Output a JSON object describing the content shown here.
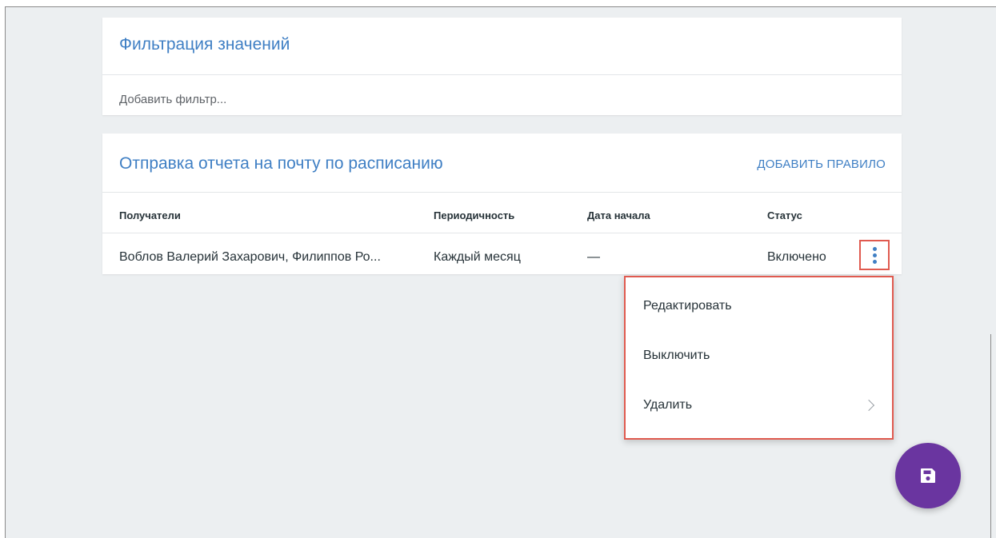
{
  "filter_card": {
    "title": "Фильтрация значений",
    "add_filter_label": "Добавить фильтр..."
  },
  "schedule_card": {
    "title": "Отправка отчета на почту по расписанию",
    "add_rule_label": "ДОБАВИТЬ ПРАВИЛО",
    "columns": [
      "Получатели",
      "Периодичность",
      "Дата начала",
      "Статус"
    ],
    "rows": [
      {
        "recipients": "Воблов Валерий Захарович, Филиппов Ро...",
        "periodicity": "Каждый месяц",
        "start_date": "—",
        "status": "Включено"
      }
    ]
  },
  "context_menu": {
    "items": [
      {
        "label": "Редактировать"
      },
      {
        "label": "Выключить"
      },
      {
        "label": "Удалить",
        "has_submenu": true
      }
    ]
  },
  "icons": {
    "row_menu": "more-vert-icon",
    "submenu": "chevron-right-icon",
    "fab": "save-icon"
  },
  "colors": {
    "accent": "#3f7fc4",
    "fab": "#6a35a0",
    "highlight": "#e05a4f",
    "background": "#eceff1"
  }
}
